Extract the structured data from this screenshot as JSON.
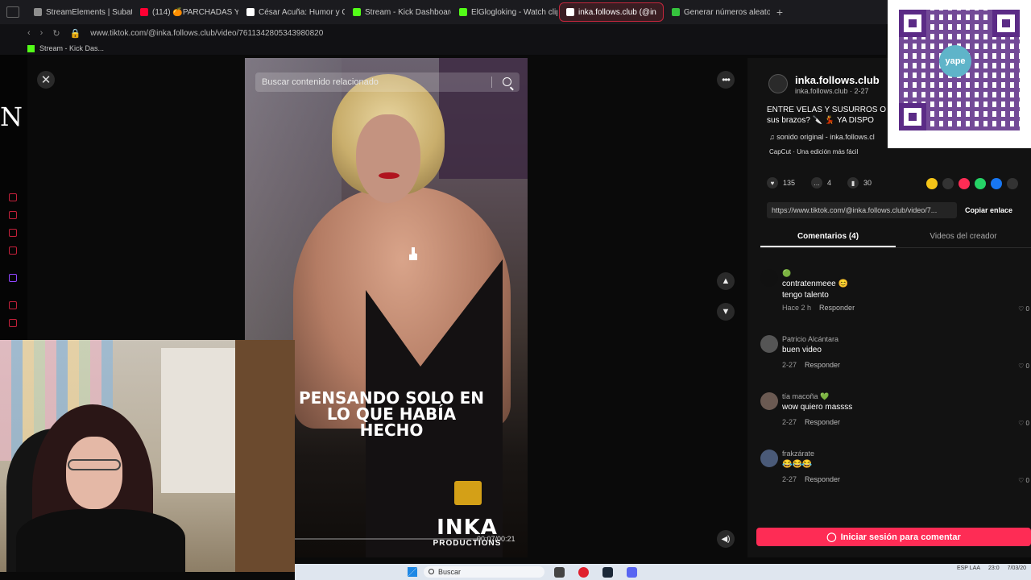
{
  "browser": {
    "tabs": [
      {
        "label": "StreamElements | Subathon",
        "color": "#8e8e8e"
      },
      {
        "label": "(114) 🍊PARCHADAS Y EN",
        "color": "#ff0033"
      },
      {
        "label": "César Acuña: Humor y Cr",
        "color": "#ffffff"
      },
      {
        "label": "Stream - Kick Dashboard",
        "color": "#53fc18"
      },
      {
        "label": "ElGlogloking - Watch clips",
        "color": "#53fc18"
      },
      {
        "label": "inka.follows.club (@in",
        "color": "#ffffff",
        "active": true
      },
      {
        "label": "Generar números aleatori",
        "color": "#35c33d"
      }
    ],
    "url": "www.tiktok.com/@inka.follows.club/video/7611342805343980820",
    "bookmark": "Stream - Kick Das..."
  },
  "overlay_letter": "N",
  "video": {
    "search_placeholder": "Buscar contenido relacionado",
    "caption": "PENSANDO SOLO EN LO QUE HABÍA HECHO",
    "brand": "INKA",
    "brand_sub": "PRODUCTIONS",
    "timecode": "00:07/00:21"
  },
  "post": {
    "author": "inka.follows.club",
    "author_sub": "inka.follows.club · 2-27",
    "description": "ENTRE VELAS Y SUSURROS O a sus brazos? 🔪 💃 YA DISPO",
    "music": "♫ sonido original - inka.follows.cl",
    "capcut": "CapCut · Una edición más fácil",
    "likes": "135",
    "comments_count": "4",
    "saves": "30",
    "link": "https://www.tiktok.com/@inka.follows.club/video/7...",
    "copy_label": "Copiar enlace",
    "tab_comments": "Comentarios (4)",
    "tab_videos": "Videos del creador"
  },
  "qr": {
    "logo": "yape"
  },
  "comments": [
    {
      "name": "🟢",
      "text": "contratenmeee 😊\ntengo talento",
      "time": "Hace 2 h",
      "reply": "Responder",
      "likes": "0"
    },
    {
      "name": "Patricio Alcántara",
      "text": "buen video",
      "time": "2-27",
      "reply": "Responder",
      "likes": "0"
    },
    {
      "name": "tía macoña 💚",
      "text": "wow quiero massss",
      "time": "2-27",
      "reply": "Responder",
      "likes": "0"
    },
    {
      "name": "frakzárate",
      "text": "😂😂😂",
      "time": "2-27",
      "reply": "Responder",
      "likes": "0"
    }
  ],
  "login_label": "Iniciar sesión para comentar",
  "taskbar": {
    "search_label": "Buscar",
    "lang": "ESP LAA",
    "clock": "23:0",
    "date": "7/03/20"
  }
}
